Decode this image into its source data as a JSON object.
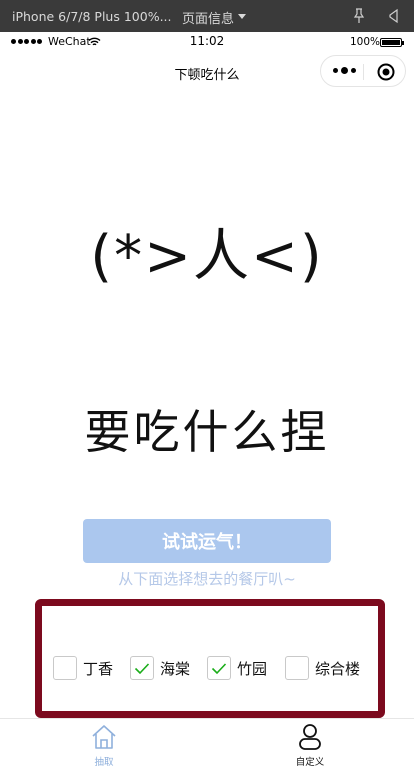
{
  "devtools": {
    "device": "iPhone 6/7/8 Plus 100%...",
    "page_info": "页面信息"
  },
  "status_bar": {
    "carrier": "WeChat",
    "time": "11:02",
    "battery": "100%"
  },
  "nav": {
    "title": "下顿吃什么"
  },
  "main": {
    "kaomoji": "(*>人<)",
    "headline": "要吃什么捏",
    "button_label": "试试运气！",
    "hint": "从下面选择想去的餐厅叭~"
  },
  "options": [
    {
      "label": "丁香",
      "checked": false
    },
    {
      "label": "海棠",
      "checked": true
    },
    {
      "label": "竹园",
      "checked": true
    },
    {
      "label": "综合楼",
      "checked": false
    }
  ],
  "tabbar": {
    "items": [
      {
        "label": "抽取",
        "icon": "home-icon",
        "active": true
      },
      {
        "label": "自定义",
        "icon": "user-icon",
        "active": false
      }
    ]
  },
  "colors": {
    "button_bg": "#abc7ee",
    "frame_border": "#7c0a1e",
    "check_green": "#1aad19",
    "active_tab": "#8fb0dc"
  }
}
